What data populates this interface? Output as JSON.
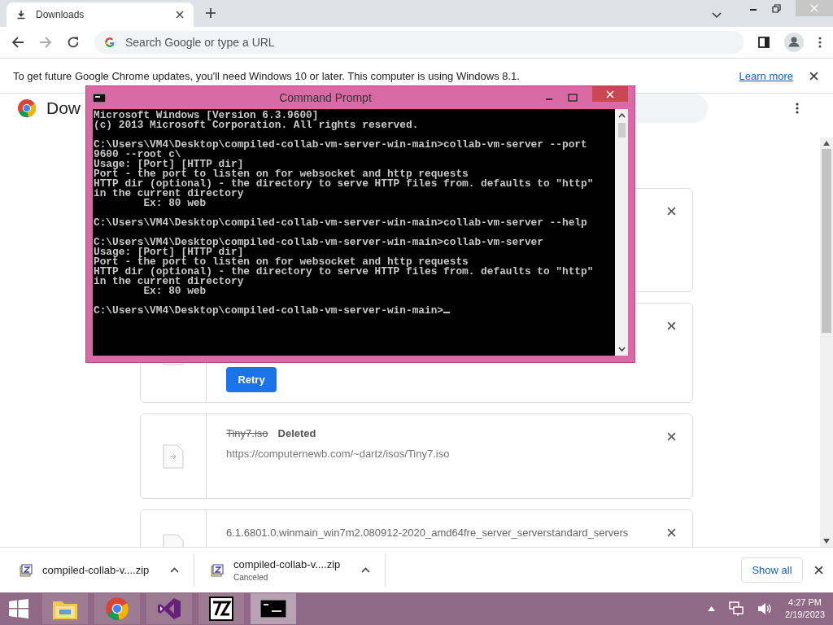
{
  "browser": {
    "tab": {
      "title": "Downloads",
      "selected": true
    },
    "omnibox": {
      "placeholder": "Search Google or type a URL"
    }
  },
  "infobar": {
    "message": "To get future Google Chrome updates, you'll need Windows 10 or later. This computer is using Windows 8.1.",
    "link": "Learn more"
  },
  "page": {
    "title": "Dow"
  },
  "cards": [
    {
      "kind": "hidden"
    },
    {
      "kind": "failed",
      "button": "Retry"
    },
    {
      "kind": "deleted",
      "name": "Tiny7.iso",
      "status": "Deleted",
      "url": "https://computernewb.com/~dartz/isos/Tiny7.iso"
    },
    {
      "kind": "partial",
      "name": "6.1.6801.0.winmain_win7m2.080912-2020_amd64fre_server_serverstandard_servers"
    }
  ],
  "console": {
    "title": "Command Prompt",
    "blocks": [
      [
        "Microsoft Windows [Version 6.3.9600]",
        "(c) 2013 Microsoft Corporation. All rights reserved."
      ],
      [
        "C:\\Users\\VM4\\Desktop\\compiled-collab-vm-server-win-main>collab-vm-server --port",
        "9600 --root c\\",
        "Usage: [Port] [HTTP dir]",
        "Port - the port to listen on for websocket and http requests",
        "HTTP dir (optional) - the directory to serve HTTP files from. defaults to \"http\"",
        "in the current directory",
        "        Ex: 80 web"
      ],
      [
        "C:\\Users\\VM4\\Desktop\\compiled-collab-vm-server-win-main>collab-vm-server --help"
      ],
      [
        "C:\\Users\\VM4\\Desktop\\compiled-collab-vm-server-win-main>collab-vm-server",
        "Usage: [Port] [HTTP dir]",
        "Port - the port to listen on for websocket and http requests",
        "HTTP dir (optional) - the directory to serve HTTP files from. defaults to \"http\"",
        "in the current directory",
        "        Ex: 80 web"
      ],
      [
        "C:\\Users\\VM4\\Desktop\\compiled-collab-vm-server-win-main>"
      ]
    ],
    "cursor": true
  },
  "shelf": {
    "items": [
      {
        "name": "compiled-collab-v....zip"
      },
      {
        "name": "compiled-collab-v....zip",
        "status": "Canceled"
      }
    ],
    "show_all": "Show all"
  },
  "taskbar": {
    "apps": [
      {
        "kind": "explorer",
        "selected": false
      },
      {
        "kind": "chrome",
        "selected": false
      },
      {
        "kind": "studio",
        "selected": false
      },
      {
        "kind": "archiver",
        "selected": false
      },
      {
        "kind": "console",
        "selected": true
      }
    ],
    "time": "4:27 PM",
    "date": "2/19/2023"
  }
}
